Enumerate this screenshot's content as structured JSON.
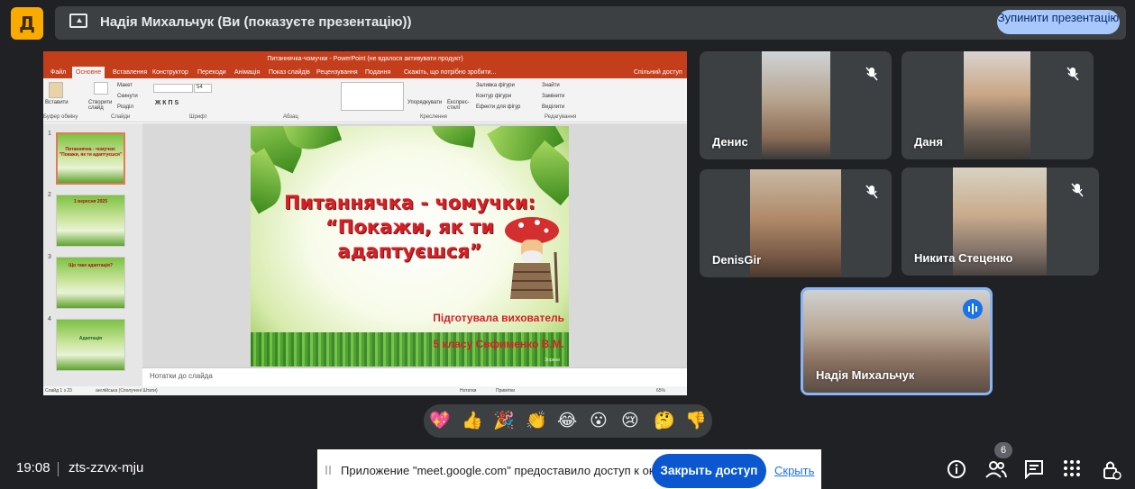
{
  "topbar": {
    "logo_glyph": "Д",
    "presenting_text": "Надія Михальчук (Ви (показуєте презентацію))",
    "stop_button": "Зупинити презентацію"
  },
  "ppt": {
    "title": "Питаннячка-чомучки - PowerPoint (не вдалося активувати продукт)",
    "tabs": [
      "Файл",
      "Основне",
      "Вставлення",
      "Конструктор",
      "Переходи",
      "Анімація",
      "Показ слайдів",
      "Рецензування",
      "Подання",
      "Скажіть, що потрібно зробити...",
      "Спільний доступ"
    ],
    "ribbon_groups": [
      "Буфер обміну",
      "Слайди",
      "Шрифт",
      "Абзац",
      "Креслення",
      "Редагування"
    ],
    "ribbon_items": {
      "paste": "Вставити",
      "new_slide": "Створити слайд",
      "layout": "Макет",
      "reset": "Скинути",
      "section": "Розділ",
      "font_size": "54",
      "arrange": "Упорядкувати",
      "quick_styles": "Експрес-стилі",
      "shape_fill": "Заливка фігури",
      "shape_outline": "Контур фігури",
      "shape_effects": "Ефекти для фігур",
      "find": "Знайти",
      "replace": "Замінити",
      "select": "Виділити"
    },
    "thumbnails": [
      {
        "num": "1",
        "text": "Питаннячка - чомучки: \"Покажи, як ти адаптуєшся\""
      },
      {
        "num": "2",
        "text": "1 вересня 2025"
      },
      {
        "num": "3",
        "text": "Що таке адаптація?"
      },
      {
        "num": "4",
        "text": "Адаптація"
      }
    ],
    "notes_placeholder": "Нотатки до слайда",
    "status": {
      "slide": "Слайд 1 з 23",
      "language": "англійська (Сполучені Штати)",
      "notes": "Нотатки",
      "comments": "Примітки",
      "zoom": "65%"
    },
    "slide": {
      "title_line1": "Питаннячка - чомучки:",
      "title_line2": "“Покажи, як ти",
      "title_line3": "адаптуєшся”",
      "author1": "Підготувала вихователь",
      "author2": "5 класу Свфименко В.М.",
      "corner": "Зорини"
    }
  },
  "participants": [
    {
      "name": "Денис",
      "muted": true
    },
    {
      "name": "Даня",
      "muted": true
    },
    {
      "name": "DenisGir",
      "muted": true
    },
    {
      "name": "Никита Стеценко",
      "muted": true
    },
    {
      "name": "Надія Михальчук",
      "speaking": true
    }
  ],
  "reactions": [
    "💖",
    "👍",
    "🎉",
    "👏",
    "😂",
    "😮",
    "😢",
    "🤔",
    "👎"
  ],
  "bottom": {
    "time": "19:08",
    "meeting_code": "zts-zzvx-mju",
    "notice": "Приложение \"meet.google.com\" предоставило доступ к окну.",
    "close_access": "Закрыть доступ",
    "hide": "Скрыть",
    "people_count": "6"
  },
  "colors": {
    "background": "#202124",
    "stop_button": "#a8c7fa",
    "close_button": "#0b57d0",
    "ppt_accent": "#c43e1c",
    "slide_title": "#d52027",
    "speaking_border": "#8ab4f8"
  },
  "icons": [
    "present-screen-icon",
    "mic-off-icon",
    "audio-speaking-icon",
    "info-icon",
    "people-icon",
    "chat-icon",
    "apps-icon",
    "host-controls-icon"
  ]
}
